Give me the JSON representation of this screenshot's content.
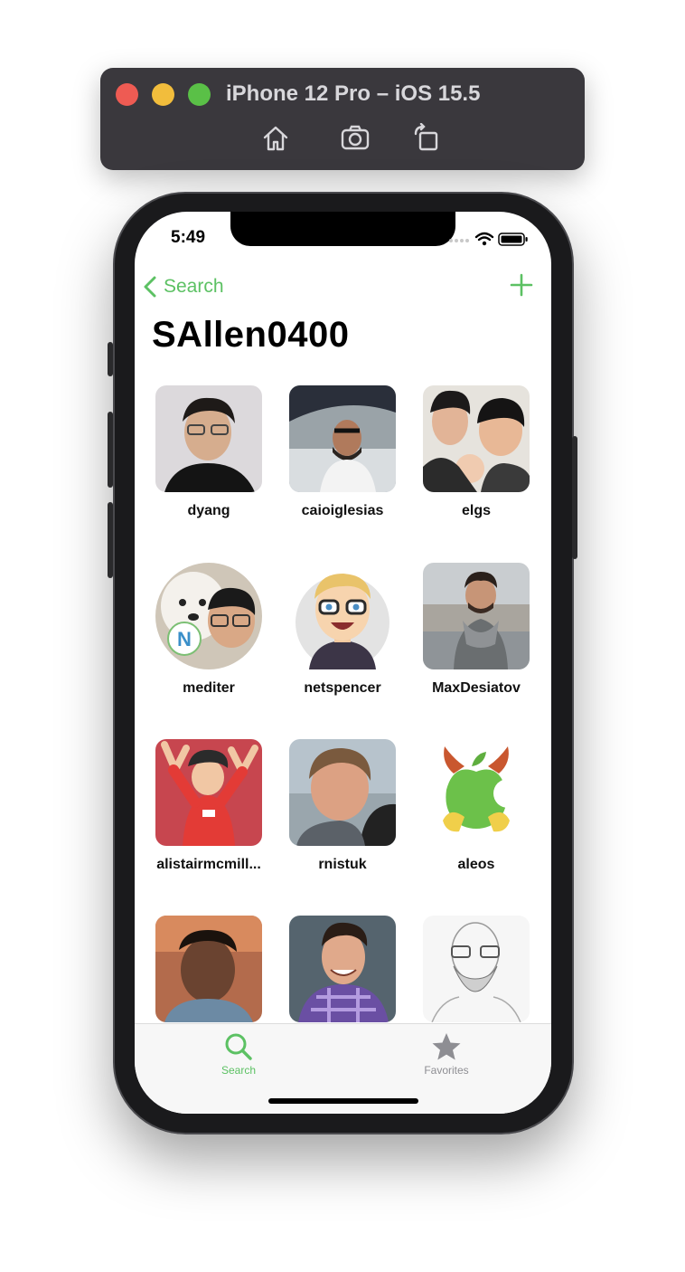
{
  "simulator": {
    "title": "iPhone 12 Pro – iOS 15.5",
    "buttons": [
      "home-icon",
      "screenshot-icon",
      "rotate-icon"
    ]
  },
  "status_bar": {
    "time": "5:49"
  },
  "nav": {
    "back_label": "Search",
    "title": "SAllen0400"
  },
  "users": [
    {
      "name": "dyang"
    },
    {
      "name": "caioiglesias"
    },
    {
      "name": "elgs"
    },
    {
      "name": "mediter"
    },
    {
      "name": "netspencer"
    },
    {
      "name": "MaxDesiatov"
    },
    {
      "name": "alistairmcmill..."
    },
    {
      "name": "rnistuk"
    },
    {
      "name": "aleos"
    },
    {
      "name": ""
    },
    {
      "name": ""
    },
    {
      "name": ""
    }
  ],
  "tabs": [
    {
      "label": "Search",
      "icon": "magnifying-glass-icon",
      "active": true
    },
    {
      "label": "Favorites",
      "icon": "star-icon",
      "active": false
    }
  ],
  "colors": {
    "accent": "#5cc163",
    "inactive": "#8e8e93"
  }
}
